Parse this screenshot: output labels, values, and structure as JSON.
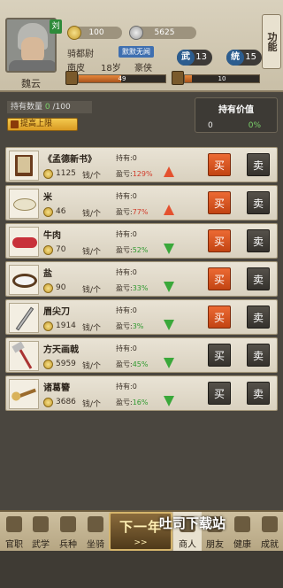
{
  "header": {
    "level_tag": "刘",
    "name": "魏云",
    "gold": "100",
    "silver": "5625",
    "rank": "骑都尉",
    "rank_tag": "默默无闻",
    "origin": "南皮",
    "age": "18岁",
    "trait": "豪侠",
    "stats": [
      {
        "label": "武",
        "value": "13"
      },
      {
        "label": "统",
        "value": "15"
      }
    ],
    "bars": [
      {
        "value": "49",
        "fill": 0.49
      },
      {
        "value": "10",
        "fill": 0.1
      }
    ],
    "func_button": "功能"
  },
  "holdings": {
    "label": "持有数量",
    "current": "0",
    "max": "/100",
    "raise_label": "提高上限",
    "value_title": "持有价值",
    "value_amount": "0",
    "value_percent": "0%"
  },
  "goods": [
    {
      "name": "《孟德新书》",
      "price": "1125",
      "unit": "钱/个",
      "held_label": "持有:",
      "held": "0",
      "pl_label": "盈亏:",
      "pct": "129%",
      "trend": "up",
      "buy": "买",
      "sell": "卖",
      "icon": "book-icon",
      "buy_enabled": true
    },
    {
      "name": "米",
      "price": "46",
      "unit": "钱/个",
      "held_label": "持有:",
      "held": "0",
      "pl_label": "盈亏:",
      "pct": "77%",
      "trend": "up",
      "buy": "买",
      "sell": "卖",
      "icon": "rice-icon",
      "buy_enabled": true
    },
    {
      "name": "牛肉",
      "price": "70",
      "unit": "钱/个",
      "held_label": "持有:",
      "held": "0",
      "pl_label": "盈亏:",
      "pct": "52%",
      "trend": "down",
      "buy": "买",
      "sell": "卖",
      "icon": "beef-icon",
      "buy_enabled": true
    },
    {
      "name": "盐",
      "price": "90",
      "unit": "钱/个",
      "held_label": "持有:",
      "held": "0",
      "pl_label": "盈亏:",
      "pct": "33%",
      "trend": "down",
      "buy": "买",
      "sell": "卖",
      "icon": "salt-icon",
      "buy_enabled": true
    },
    {
      "name": "眉尖刀",
      "price": "1914",
      "unit": "钱/个",
      "held_label": "持有:",
      "held": "0",
      "pl_label": "盈亏:",
      "pct": "3%",
      "trend": "down",
      "buy": "买",
      "sell": "卖",
      "icon": "blade-icon",
      "buy_enabled": true
    },
    {
      "name": "方天画戟",
      "price": "5959",
      "unit": "钱/个",
      "held_label": "持有:",
      "held": "0",
      "pl_label": "盈亏:",
      "pct": "45%",
      "trend": "down",
      "buy": "买",
      "sell": "卖",
      "icon": "halberd-icon",
      "buy_enabled": false
    },
    {
      "name": "诸葛簪",
      "price": "3686",
      "unit": "钱/个",
      "held_label": "持有:",
      "held": "0",
      "pl_label": "盈亏:",
      "pct": "16%",
      "trend": "down",
      "buy": "买",
      "sell": "卖",
      "icon": "hairpin-icon",
      "buy_enabled": false
    }
  ],
  "nav": {
    "items": [
      "官职",
      "武学",
      "兵种",
      "坐骑",
      "商人",
      "朋友",
      "健康",
      "成就"
    ],
    "active": "商人",
    "next_label": "下一年",
    "next_sub": ">>"
  },
  "watermark": "吐司下载站",
  "colors": {
    "buy": "#d2531f",
    "sell": "#3f3c36",
    "up": "#e4512f",
    "down": "#3aa83a"
  }
}
